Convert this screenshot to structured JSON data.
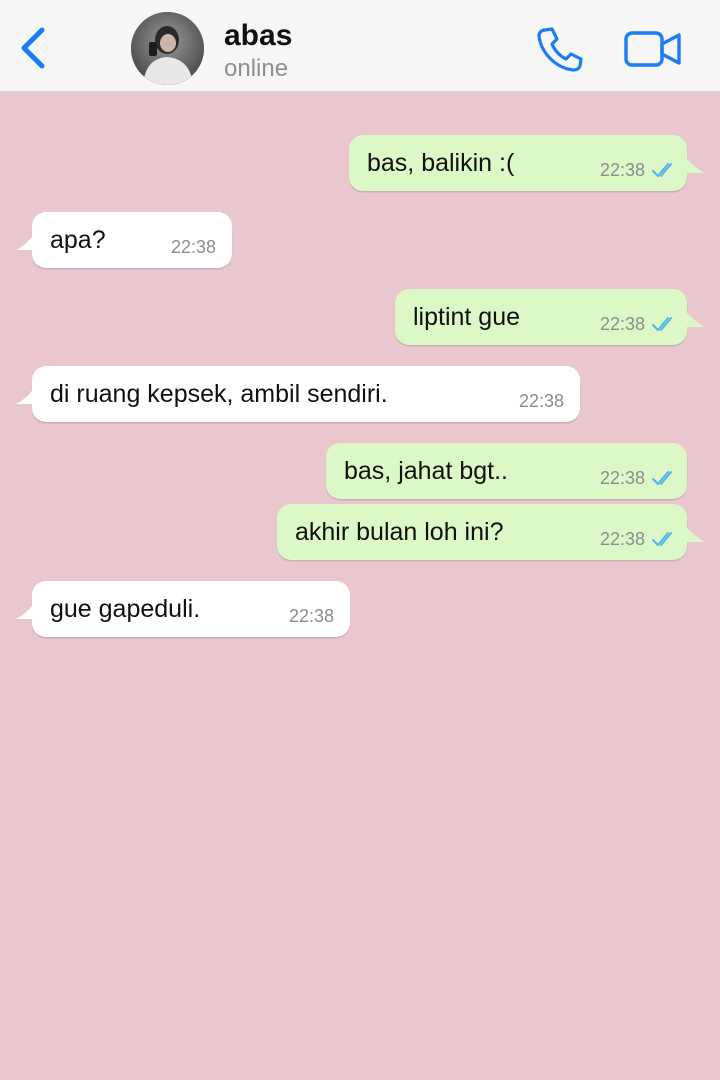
{
  "header": {
    "contact_name": "abas",
    "contact_status": "online",
    "icons": {
      "back": "chevron-left-icon",
      "call": "phone-icon",
      "video": "video-camera-icon"
    },
    "accent_color": "#1b7cf5"
  },
  "chat": {
    "background_color": "#eac6ce",
    "outgoing_bubble_color": "#dcf8c6",
    "incoming_bubble_color": "#ffffff",
    "read_tick_color": "#4fb6ec",
    "messages": [
      {
        "direction": "out",
        "text": "bas, balikin :(",
        "time": "22:38",
        "status": "read"
      },
      {
        "direction": "in",
        "text": "apa?",
        "time": "22:38"
      },
      {
        "direction": "out",
        "text": "liptint gue",
        "time": "22:38",
        "status": "read"
      },
      {
        "direction": "in",
        "text": "di ruang kepsek, ambil sendiri.",
        "time": "22:38"
      },
      {
        "direction": "out",
        "text": "bas, jahat bgt..",
        "time": "22:38",
        "status": "read"
      },
      {
        "direction": "out",
        "text": "akhir bulan loh ini?",
        "time": "22:38",
        "status": "read"
      },
      {
        "direction": "in",
        "text": "gue gapeduli.",
        "time": "22:38"
      }
    ]
  }
}
